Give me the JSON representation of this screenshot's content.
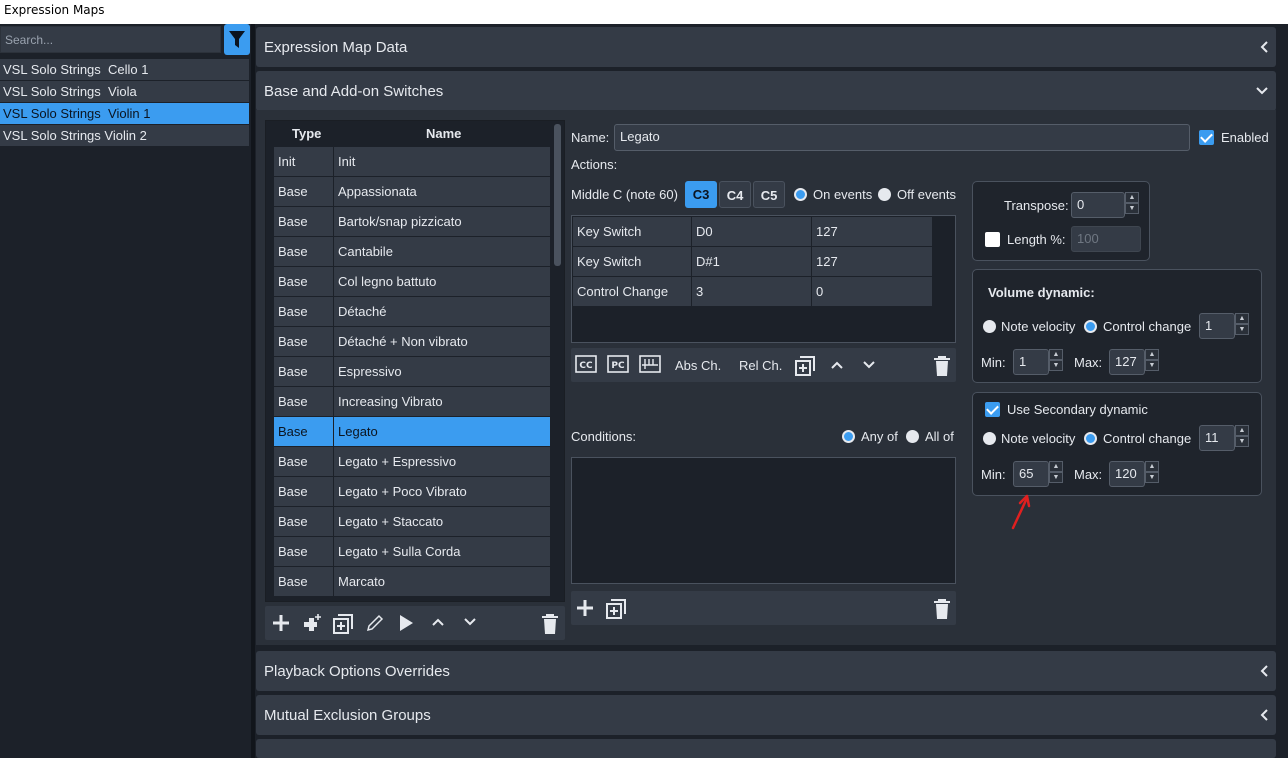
{
  "window": {
    "title": "Expression Maps"
  },
  "left_panel": {
    "search_placeholder": "Search...",
    "maps": [
      "VSL Solo Strings  Cello 1",
      "VSL Solo Strings  Viola",
      "VSL Solo Strings  Violin 1",
      "VSL Solo Strings Violin 2"
    ],
    "selected_index": 2
  },
  "sections": {
    "expression_map_data": "Expression Map Data",
    "base_addon_switches": "Base and Add-on Switches",
    "playback_overrides": "Playback Options Overrides",
    "mutual_exclusion": "Mutual Exclusion Groups"
  },
  "switch_table": {
    "headers": {
      "type": "Type",
      "name": "Name"
    },
    "rows": [
      {
        "type": "Init",
        "name": "Init"
      },
      {
        "type": "Base",
        "name": "Appassionata"
      },
      {
        "type": "Base",
        "name": "Bartok/snap pizzicato"
      },
      {
        "type": "Base",
        "name": "Cantabile"
      },
      {
        "type": "Base",
        "name": "Col legno battuto"
      },
      {
        "type": "Base",
        "name": "Détaché"
      },
      {
        "type": "Base",
        "name": "Détaché + Non vibrato"
      },
      {
        "type": "Base",
        "name": "Espressivo"
      },
      {
        "type": "Base",
        "name": "Increasing Vibrato"
      },
      {
        "type": "Base",
        "name": "Legato"
      },
      {
        "type": "Base",
        "name": "Legato + Espressivo"
      },
      {
        "type": "Base",
        "name": "Legato + Poco Vibrato"
      },
      {
        "type": "Base",
        "name": "Legato + Staccato"
      },
      {
        "type": "Base",
        "name": "Legato + Sulla Corda"
      },
      {
        "type": "Base",
        "name": "Marcato"
      }
    ],
    "selected_index": 9
  },
  "detail": {
    "name_label": "Name:",
    "name_value": "Legato",
    "enabled_label": "Enabled",
    "enabled": true,
    "actions_label": "Actions:",
    "middle_c_label": "Middle C (note 60)",
    "middle_c_options": [
      "C3",
      "C4",
      "C5"
    ],
    "middle_c_selected": "C3",
    "on_events_label": "On events",
    "off_events_label": "Off events",
    "actions": [
      [
        "Key Switch",
        "D0",
        "127"
      ],
      [
        "Key Switch",
        "D#1",
        "127"
      ],
      [
        "Control Change",
        "3",
        "0"
      ]
    ],
    "action_toolbar": {
      "abs_ch": "Abs Ch.",
      "rel_ch": "Rel Ch."
    },
    "conditions_label": "Conditions:",
    "any_of_label": "Any of",
    "all_of_label": "All of"
  },
  "transpose": {
    "label": "Transpose:",
    "value": "0",
    "length_label": "Length %:",
    "length_value": "100",
    "length_enabled": false
  },
  "volume_dynamic": {
    "title": "Volume dynamic:",
    "note_velocity_label": "Note velocity",
    "control_change_label": "Control change",
    "cc_value": "1",
    "min_label": "Min:",
    "min_value": "1",
    "max_label": "Max:",
    "max_value": "127"
  },
  "secondary_dynamic": {
    "title": "Use Secondary dynamic",
    "enabled": true,
    "note_velocity_label": "Note velocity",
    "control_change_label": "Control change",
    "cc_value": "11",
    "min_label": "Min:",
    "min_value": "65",
    "max_label": "Max:",
    "max_value": "120"
  },
  "colors": {
    "accent": "#3b9cf0",
    "panel": "#343b46",
    "background": "#1c2129",
    "annotation": "#e02020"
  }
}
